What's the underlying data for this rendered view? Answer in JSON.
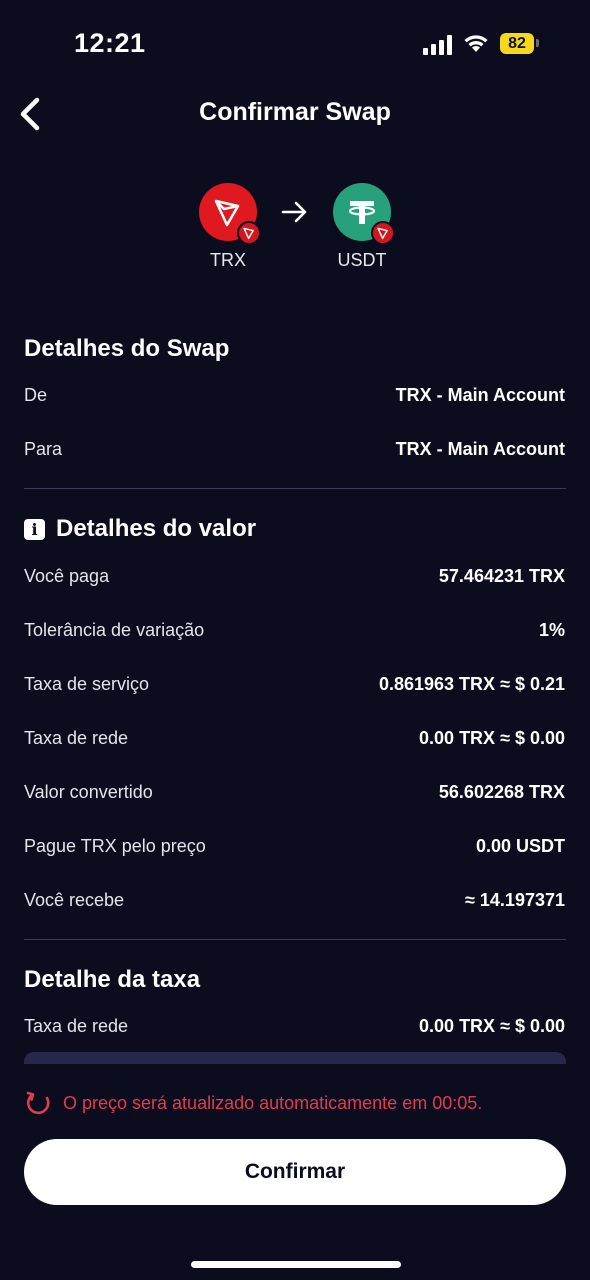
{
  "status_bar": {
    "time": "12:21",
    "battery": "82"
  },
  "header": {
    "title": "Confirmar Swap",
    "back_icon": "chevron-left-icon"
  },
  "pair": {
    "from_symbol": "TRX",
    "to_symbol": "USDT",
    "from_color": "#e0181f",
    "to_color": "#26a17b"
  },
  "swap_details": {
    "title": "Detalhes do Swap",
    "rows": [
      {
        "label": "De",
        "value": "TRX - Main Account"
      },
      {
        "label": "Para",
        "value": "TRX - Main Account"
      }
    ]
  },
  "value_details": {
    "title": "Detalhes do valor",
    "rows": [
      {
        "label": "Você paga",
        "value": "57.464231 TRX"
      },
      {
        "label": "Tolerância de variação",
        "value": "1%"
      },
      {
        "label": "Taxa de serviço",
        "value": "0.861963 TRX ≈ $ 0.21"
      },
      {
        "label": "Taxa de rede",
        "value": "0.00 TRX ≈ $ 0.00"
      },
      {
        "label": "Valor convertido",
        "value": "56.602268 TRX"
      },
      {
        "label": "Pague TRX pelo preço",
        "value": "0.00 USDT"
      },
      {
        "label": "Você recebe",
        "value": "≈ 14.197371"
      }
    ]
  },
  "fee_details": {
    "title": "Detalhe da taxa",
    "rows": [
      {
        "label": "Taxa de rede",
        "value": "0.00 TRX ≈ $ 0.00"
      }
    ]
  },
  "refresh_notice": "O preço será atualizado automaticamente em 00:05.",
  "confirm_label": "Confirmar",
  "colors": {
    "background": "#0b0d1f",
    "warning": "#e23b4e",
    "battery": "#f4d91c"
  }
}
